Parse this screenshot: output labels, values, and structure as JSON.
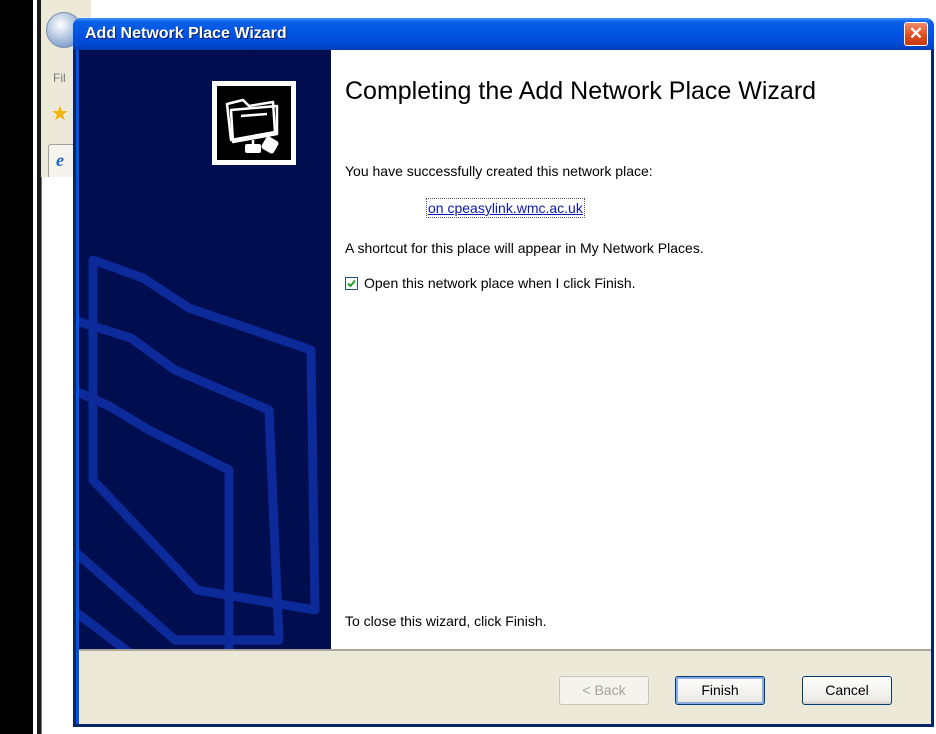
{
  "background_app": {
    "menu_partial": "Fil"
  },
  "dialog": {
    "title": "Add Network Place Wizard",
    "close_label": "✕",
    "heading": "Completing the Add Network Place Wizard",
    "success_text": "You have successfully created this network place:",
    "place_link": "on cpeasylink.wmc.ac.uk",
    "shortcut_text": "A shortcut for this place will appear in My Network Places.",
    "open_checkbox": {
      "label": "Open this network place when I click Finish.",
      "checked": true
    },
    "closing_text": "To close this wizard, click Finish.",
    "buttons": {
      "back": "< Back",
      "finish": "Finish",
      "cancel": "Cancel"
    },
    "icons": [
      "network-folder-icon",
      "close-icon",
      "checkmark-icon"
    ],
    "colors": {
      "sidebar": "#000e50",
      "titlebar": "#0054e3",
      "link": "#0a18b5"
    }
  }
}
